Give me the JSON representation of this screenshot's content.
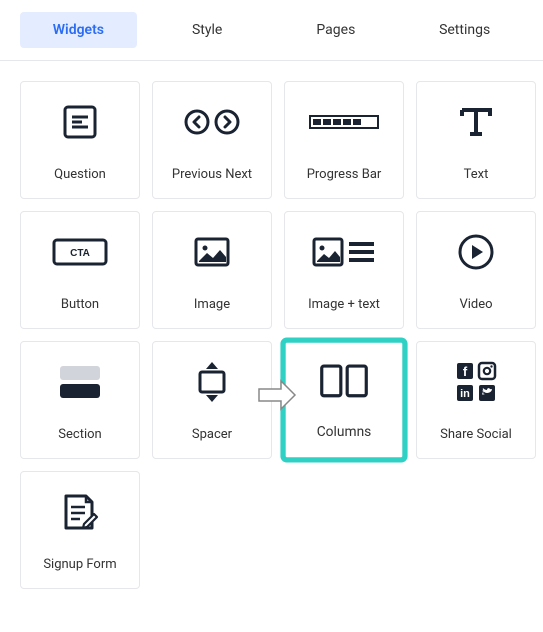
{
  "tabs": {
    "widgets": "Widgets",
    "style": "Style",
    "pages": "Pages",
    "settings": "Settings",
    "active": "widgets"
  },
  "widgets": {
    "question": "Question",
    "previous_next": "Previous Next",
    "progress_bar": "Progress Bar",
    "text": "Text",
    "button": "Button",
    "image": "Image",
    "image_text": "Image + text",
    "video": "Video",
    "section": "Section",
    "spacer": "Spacer",
    "columns": "Columns",
    "share_social": "Share Social",
    "signup_form": "Signup Form"
  },
  "highlighted": "columns"
}
